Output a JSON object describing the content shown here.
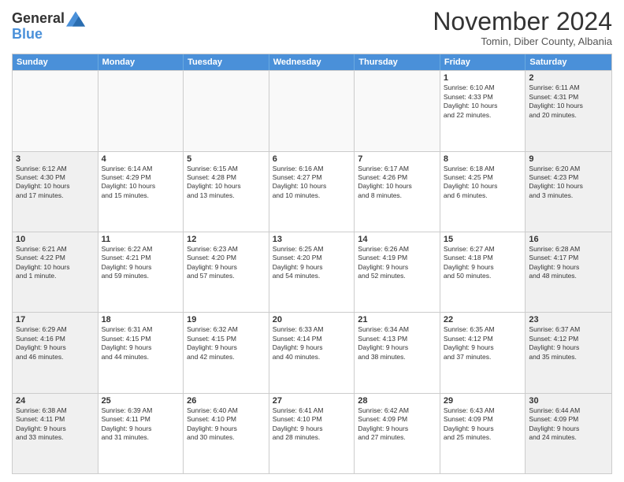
{
  "logo": {
    "line1": "General",
    "line2": "Blue"
  },
  "title": "November 2024",
  "subtitle": "Tomin, Diber County, Albania",
  "header": {
    "days": [
      "Sunday",
      "Monday",
      "Tuesday",
      "Wednesday",
      "Thursday",
      "Friday",
      "Saturday"
    ]
  },
  "rows": [
    [
      {
        "day": "",
        "text": "",
        "empty": true
      },
      {
        "day": "",
        "text": "",
        "empty": true
      },
      {
        "day": "",
        "text": "",
        "empty": true
      },
      {
        "day": "",
        "text": "",
        "empty": true
      },
      {
        "day": "",
        "text": "",
        "empty": true
      },
      {
        "day": "1",
        "text": "Sunrise: 6:10 AM\nSunset: 4:33 PM\nDaylight: 10 hours\nand 22 minutes.",
        "empty": false
      },
      {
        "day": "2",
        "text": "Sunrise: 6:11 AM\nSunset: 4:31 PM\nDaylight: 10 hours\nand 20 minutes.",
        "empty": false,
        "shaded": true
      }
    ],
    [
      {
        "day": "3",
        "text": "Sunrise: 6:12 AM\nSunset: 4:30 PM\nDaylight: 10 hours\nand 17 minutes.",
        "empty": false,
        "shaded": true
      },
      {
        "day": "4",
        "text": "Sunrise: 6:14 AM\nSunset: 4:29 PM\nDaylight: 10 hours\nand 15 minutes.",
        "empty": false
      },
      {
        "day": "5",
        "text": "Sunrise: 6:15 AM\nSunset: 4:28 PM\nDaylight: 10 hours\nand 13 minutes.",
        "empty": false
      },
      {
        "day": "6",
        "text": "Sunrise: 6:16 AM\nSunset: 4:27 PM\nDaylight: 10 hours\nand 10 minutes.",
        "empty": false
      },
      {
        "day": "7",
        "text": "Sunrise: 6:17 AM\nSunset: 4:26 PM\nDaylight: 10 hours\nand 8 minutes.",
        "empty": false
      },
      {
        "day": "8",
        "text": "Sunrise: 6:18 AM\nSunset: 4:25 PM\nDaylight: 10 hours\nand 6 minutes.",
        "empty": false
      },
      {
        "day": "9",
        "text": "Sunrise: 6:20 AM\nSunset: 4:23 PM\nDaylight: 10 hours\nand 3 minutes.",
        "empty": false,
        "shaded": true
      }
    ],
    [
      {
        "day": "10",
        "text": "Sunrise: 6:21 AM\nSunset: 4:22 PM\nDaylight: 10 hours\nand 1 minute.",
        "empty": false,
        "shaded": true
      },
      {
        "day": "11",
        "text": "Sunrise: 6:22 AM\nSunset: 4:21 PM\nDaylight: 9 hours\nand 59 minutes.",
        "empty": false
      },
      {
        "day": "12",
        "text": "Sunrise: 6:23 AM\nSunset: 4:20 PM\nDaylight: 9 hours\nand 57 minutes.",
        "empty": false
      },
      {
        "day": "13",
        "text": "Sunrise: 6:25 AM\nSunset: 4:20 PM\nDaylight: 9 hours\nand 54 minutes.",
        "empty": false
      },
      {
        "day": "14",
        "text": "Sunrise: 6:26 AM\nSunset: 4:19 PM\nDaylight: 9 hours\nand 52 minutes.",
        "empty": false
      },
      {
        "day": "15",
        "text": "Sunrise: 6:27 AM\nSunset: 4:18 PM\nDaylight: 9 hours\nand 50 minutes.",
        "empty": false
      },
      {
        "day": "16",
        "text": "Sunrise: 6:28 AM\nSunset: 4:17 PM\nDaylight: 9 hours\nand 48 minutes.",
        "empty": false,
        "shaded": true
      }
    ],
    [
      {
        "day": "17",
        "text": "Sunrise: 6:29 AM\nSunset: 4:16 PM\nDaylight: 9 hours\nand 46 minutes.",
        "empty": false,
        "shaded": true
      },
      {
        "day": "18",
        "text": "Sunrise: 6:31 AM\nSunset: 4:15 PM\nDaylight: 9 hours\nand 44 minutes.",
        "empty": false
      },
      {
        "day": "19",
        "text": "Sunrise: 6:32 AM\nSunset: 4:15 PM\nDaylight: 9 hours\nand 42 minutes.",
        "empty": false
      },
      {
        "day": "20",
        "text": "Sunrise: 6:33 AM\nSunset: 4:14 PM\nDaylight: 9 hours\nand 40 minutes.",
        "empty": false
      },
      {
        "day": "21",
        "text": "Sunrise: 6:34 AM\nSunset: 4:13 PM\nDaylight: 9 hours\nand 38 minutes.",
        "empty": false
      },
      {
        "day": "22",
        "text": "Sunrise: 6:35 AM\nSunset: 4:12 PM\nDaylight: 9 hours\nand 37 minutes.",
        "empty": false
      },
      {
        "day": "23",
        "text": "Sunrise: 6:37 AM\nSunset: 4:12 PM\nDaylight: 9 hours\nand 35 minutes.",
        "empty": false,
        "shaded": true
      }
    ],
    [
      {
        "day": "24",
        "text": "Sunrise: 6:38 AM\nSunset: 4:11 PM\nDaylight: 9 hours\nand 33 minutes.",
        "empty": false,
        "shaded": true
      },
      {
        "day": "25",
        "text": "Sunrise: 6:39 AM\nSunset: 4:11 PM\nDaylight: 9 hours\nand 31 minutes.",
        "empty": false
      },
      {
        "day": "26",
        "text": "Sunrise: 6:40 AM\nSunset: 4:10 PM\nDaylight: 9 hours\nand 30 minutes.",
        "empty": false
      },
      {
        "day": "27",
        "text": "Sunrise: 6:41 AM\nSunset: 4:10 PM\nDaylight: 9 hours\nand 28 minutes.",
        "empty": false
      },
      {
        "day": "28",
        "text": "Sunrise: 6:42 AM\nSunset: 4:09 PM\nDaylight: 9 hours\nand 27 minutes.",
        "empty": false
      },
      {
        "day": "29",
        "text": "Sunrise: 6:43 AM\nSunset: 4:09 PM\nDaylight: 9 hours\nand 25 minutes.",
        "empty": false
      },
      {
        "day": "30",
        "text": "Sunrise: 6:44 AM\nSunset: 4:09 PM\nDaylight: 9 hours\nand 24 minutes.",
        "empty": false,
        "shaded": true
      }
    ]
  ]
}
